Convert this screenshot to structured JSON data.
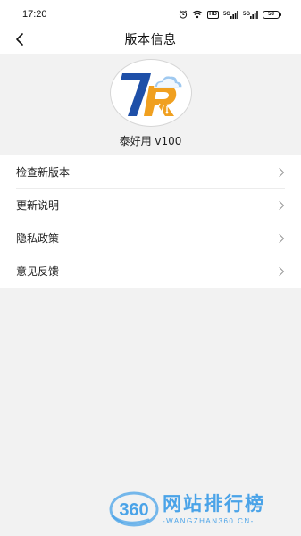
{
  "status_bar": {
    "time": "17:20",
    "hd_label": "HD",
    "network_1": "5G",
    "network_2": "5G",
    "battery": "58",
    "icons": [
      "alarm-icon",
      "wifi-icon",
      "hd-icon",
      "signal-icon",
      "signal-icon",
      "battery-icon"
    ]
  },
  "header": {
    "back_icon": "chevron-left-icon",
    "title": "版本信息"
  },
  "app": {
    "logo_icon": "tr-cloud-logo",
    "version": "泰好用 v100"
  },
  "menu": {
    "items": [
      {
        "label": "检查新版本",
        "icon": "chevron-right-icon"
      },
      {
        "label": "更新说明",
        "icon": "chevron-right-icon"
      },
      {
        "label": "隐私政策",
        "icon": "chevron-right-icon"
      },
      {
        "label": "意见反馈",
        "icon": "chevron-right-icon"
      }
    ]
  },
  "watermark": {
    "logo_text": "360",
    "title": "网站排行榜",
    "subtitle": "-WANGZHAN360.CN-"
  },
  "colors": {
    "background": "#f2f2f2",
    "surface": "#ffffff",
    "logo_blue": "#1e4fa8",
    "logo_orange": "#f0a020",
    "watermark_blue": "#4aa3e8"
  }
}
